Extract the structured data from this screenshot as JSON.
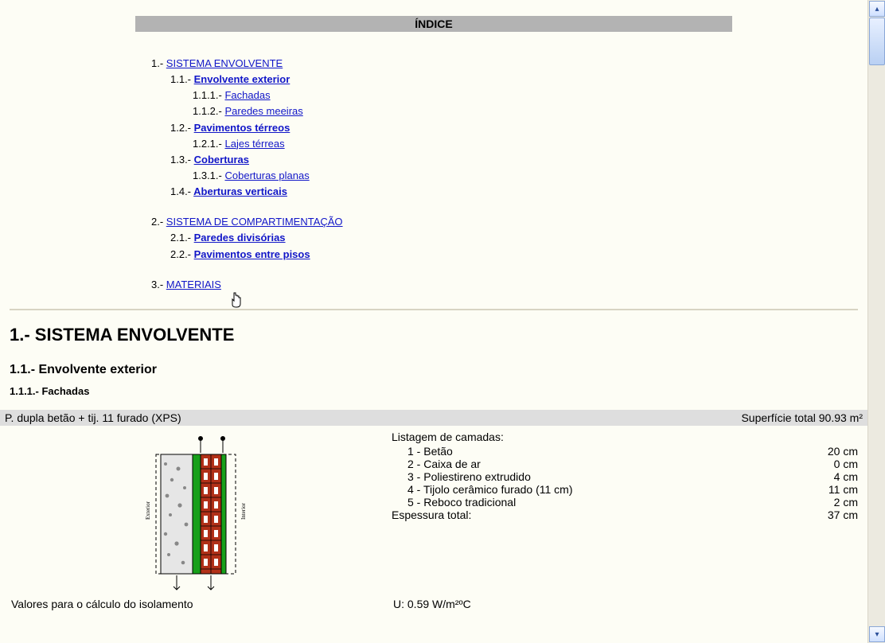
{
  "index_title": "ÍNDICE",
  "toc": {
    "s1": {
      "num": "1.-",
      "title": "SISTEMA ENVOLVENTE",
      "s11": {
        "num": "1.1.-",
        "title": "Envolvente exterior",
        "s111": {
          "num": "1.1.1.-",
          "title": "Fachadas"
        },
        "s112": {
          "num": "1.1.2.-",
          "title": "Paredes meeiras"
        }
      },
      "s12": {
        "num": "1.2.-",
        "title": "Pavimentos térreos",
        "s121": {
          "num": "1.2.1.-",
          "title": "Lajes térreas"
        }
      },
      "s13": {
        "num": "1.3.-",
        "title": "Coberturas",
        "s131": {
          "num": "1.3.1.-",
          "title": "Coberturas planas"
        }
      },
      "s14": {
        "num": "1.4.-",
        "title": "Aberturas verticais"
      }
    },
    "s2": {
      "num": "2.-",
      "title": "SISTEMA DE COMPARTIMENTAÇÃO",
      "s21": {
        "num": "2.1.-",
        "title": "Paredes divisórias"
      },
      "s22": {
        "num": "2.2.-",
        "title": "Pavimentos entre pisos"
      }
    },
    "s3": {
      "num": "3.-",
      "title": "MATERIAIS"
    }
  },
  "section1": {
    "heading": "1.- SISTEMA ENVOLVENTE",
    "sub11": "1.1.- Envolvente exterior",
    "sub111": "1.1.1.- Fachadas"
  },
  "wall": {
    "name": "P. dupla betão + tij. 11 furado (XPS)",
    "surface_label": "Superfície total 90.93 m²",
    "layers_title": "Listagem de camadas:",
    "layers": {
      "l1": {
        "label": "1 - Betão",
        "val": "20 cm"
      },
      "l2": {
        "label": "2 - Caixa de ar",
        "val": "0 cm"
      },
      "l3": {
        "label": "3 - Poliestireno extrudido",
        "val": "4 cm"
      },
      "l4": {
        "label": "4 - Tijolo cerâmico furado (11 cm)",
        "val": "11 cm"
      },
      "l5": {
        "label": "5 - Reboco tradicional",
        "val": "2 cm"
      }
    },
    "thickness_label": "Espessura total:",
    "thickness_val": "37 cm",
    "exterior_label": "Exterior",
    "interior_label": "Interior"
  },
  "iso": {
    "left": "Valores para o cálculo do isolamento",
    "u": "U: 0.59 W/m²ºC"
  }
}
